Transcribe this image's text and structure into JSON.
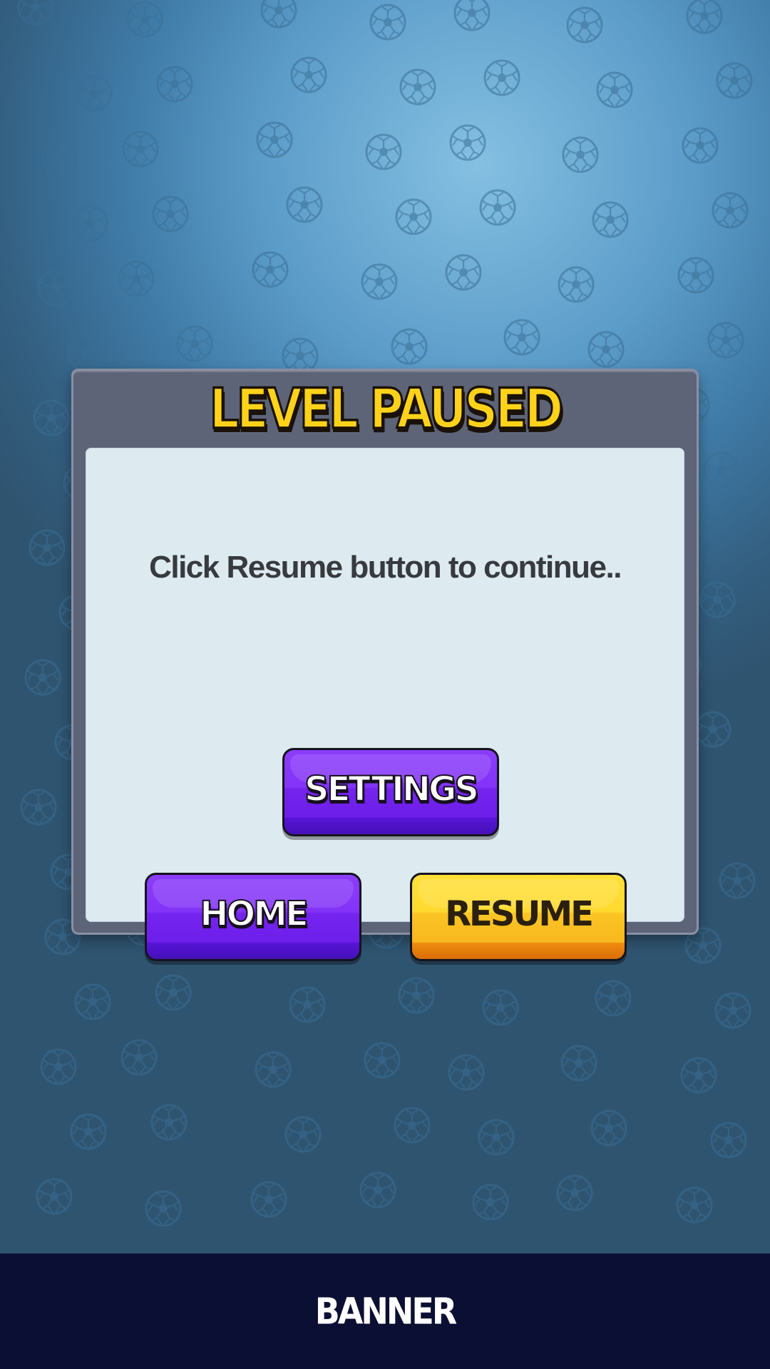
{
  "dialog": {
    "title": "LEVEL PAUSED",
    "message": "Click Resume button to continue.."
  },
  "buttons": {
    "settings": "SETTINGS",
    "home": "HOME",
    "resume": "RESUME"
  },
  "banner": {
    "label": "BANNER"
  },
  "background": {
    "pattern_icon": "soccer-ball-icon"
  },
  "colors": {
    "title": "#ffd21a",
    "purple_button": "#7f2ff5",
    "yellow_button": "#fcc425",
    "dialog_frame": "#5e6478",
    "dialog_panel": "#ddeaf0",
    "banner": "#0b0f33"
  }
}
